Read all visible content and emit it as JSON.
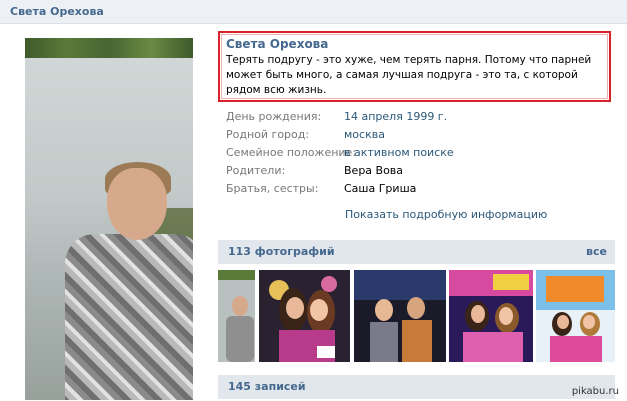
{
  "header": {
    "name": "Света Орехова"
  },
  "status": {
    "name": "Света Орехова",
    "text": "Терять подругу - это хуже, чем терять парня. Потому что парней может быть много, а самая лучшая подруга - это та, с которой рядом всю жизнь."
  },
  "profile_fields": [
    {
      "label": "День рождения:",
      "value": "14 апреля 1999 г."
    },
    {
      "label": "Родной город:",
      "value": "москва"
    },
    {
      "label": "Семейное положение:",
      "value": "в активном поиске"
    },
    {
      "label": "Родители:",
      "value": "Вера Вова"
    },
    {
      "label": "Братья, сестры:",
      "value": "Саша Гриша"
    }
  ],
  "more_info_link": "Показать подробную информацию",
  "photos": {
    "title": "113 фотографий",
    "all_link": "все"
  },
  "posts": {
    "title": "145 записей"
  },
  "watermark": "pikabu.ru",
  "colors": {
    "vk_blue": "#45688e",
    "link": "#2b587a",
    "highlight_border": "#d8222a",
    "header_bg": "#edf1f5"
  }
}
